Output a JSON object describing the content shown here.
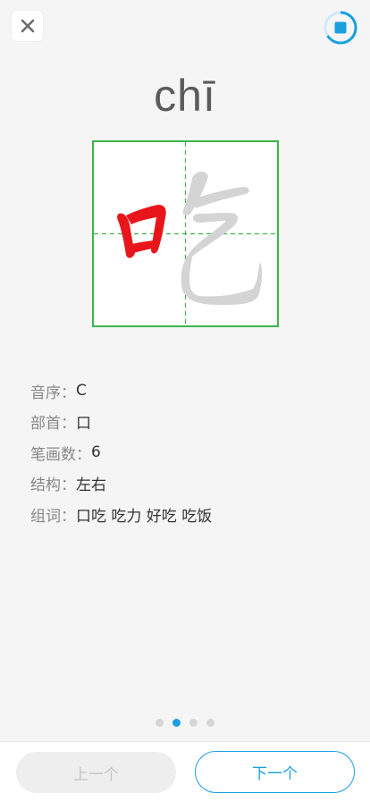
{
  "header": {
    "close_icon": "close-icon",
    "stop_icon": "stop-icon",
    "accent_color": "#1a9fe0"
  },
  "character": {
    "pinyin": "chī",
    "glyph": "吃",
    "highlight_color": "#e8161b",
    "grid_color": "#3bb54a"
  },
  "info": {
    "rows": [
      {
        "label": "音序：",
        "value": "C"
      },
      {
        "label": "部首：",
        "value": "口"
      },
      {
        "label": "笔画数：",
        "value": "6"
      },
      {
        "label": "结构：",
        "value": "左右"
      },
      {
        "label": "组词：",
        "value": "口吃 吃力 好吃 吃饭"
      }
    ]
  },
  "pagination": {
    "total": 4,
    "current": 2
  },
  "footer": {
    "prev_label": "上一个",
    "next_label": "下一个"
  }
}
